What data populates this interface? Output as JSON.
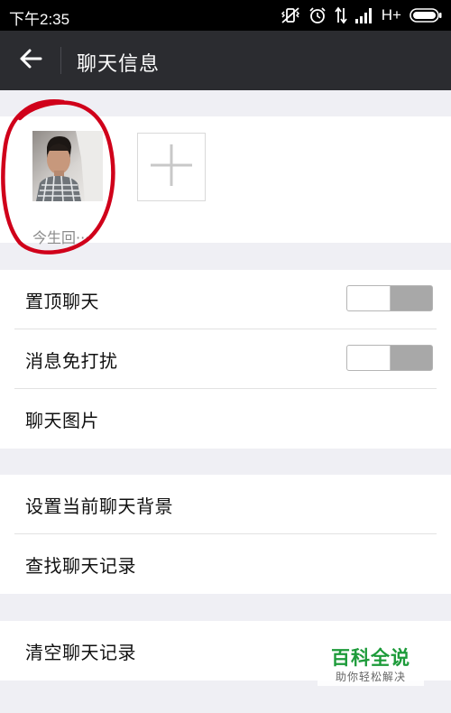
{
  "status_bar": {
    "time": "下午2:35",
    "network": "H+"
  },
  "header": {
    "title": "聊天信息"
  },
  "members": [
    {
      "name": "今生回···"
    }
  ],
  "settings_group_1": [
    {
      "label": "置顶聊天",
      "toggle": false
    },
    {
      "label": "消息免打扰",
      "toggle": false
    },
    {
      "label": "聊天图片"
    }
  ],
  "settings_group_2": [
    {
      "label": "设置当前聊天背景"
    },
    {
      "label": "查找聊天记录"
    }
  ],
  "settings_group_3": [
    {
      "label": "清空聊天记录"
    }
  ],
  "watermark": {
    "title": "百科全说",
    "subtitle": "助你轻松解决"
  },
  "colors": {
    "status_bar": "#000000",
    "app_bar": "#2b2c30",
    "background": "#efeff4",
    "annotation_red": "#d0001a",
    "toggle_off": "#a8a8a8",
    "watermark_green": "#1d9b3a"
  },
  "icons": {
    "back": "arrow-left-icon",
    "add_member": "plus-icon"
  }
}
